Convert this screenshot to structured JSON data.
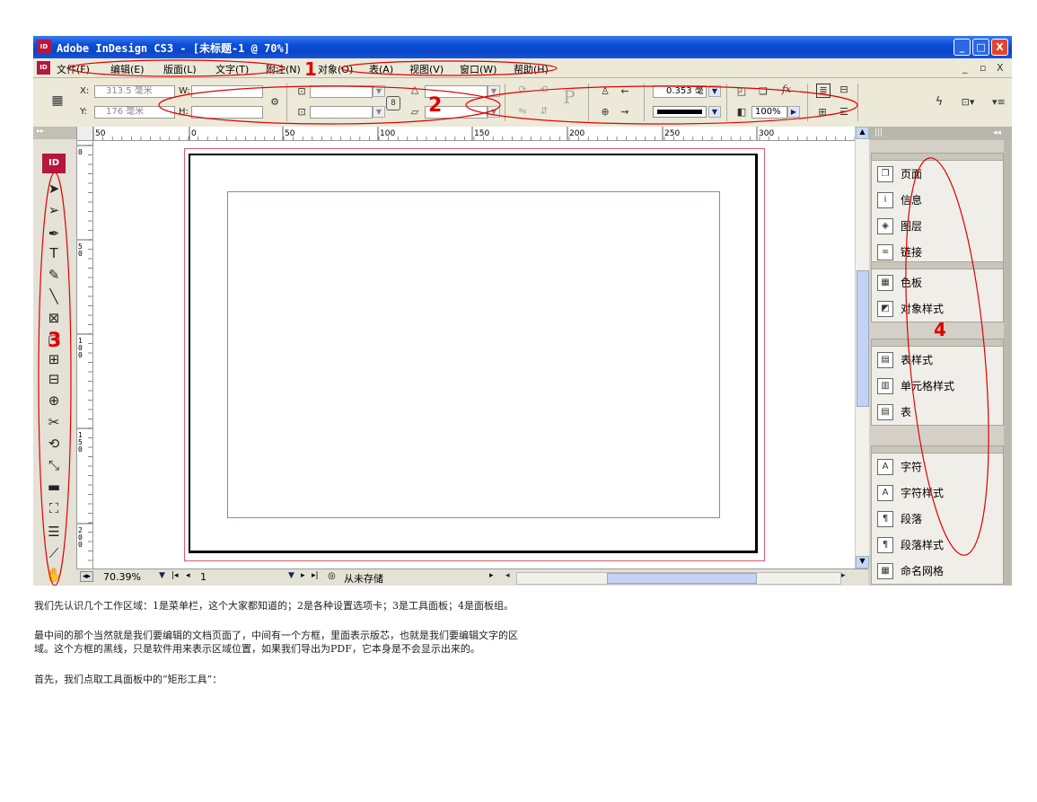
{
  "window": {
    "title": "Adobe InDesign CS3 - [未标题-1 @ 70%]",
    "logo_text": "ID",
    "buttons": {
      "minimize": "_",
      "maximize": "□",
      "close": "X"
    }
  },
  "menubar": {
    "items": [
      "文件(F)",
      "编辑(E)",
      "版面(L)",
      "文字(T)",
      "附注(N)",
      "对象(O)",
      "表(A)",
      "视图(V)",
      "窗口(W)",
      "帮助(H)"
    ],
    "mdi": {
      "minimize": "_",
      "restore": "ቹ",
      "close": "X"
    }
  },
  "control_panel": {
    "x_label": "X:",
    "x_value": "313.5 毫米",
    "y_label": "Y:",
    "y_value": "176 毫米",
    "w_label": "W:",
    "h_label": "H:",
    "stroke_weight": "0.353 毫",
    "zoom_percent": "100%"
  },
  "rulers": {
    "h_labels": [
      "50",
      "0",
      "50",
      "100",
      "150",
      "200",
      "250",
      "300"
    ],
    "v_labels": [
      "0",
      "50",
      "100",
      "150",
      "200"
    ]
  },
  "tools": {
    "logo_text": "ID",
    "items": [
      {
        "icon": "selection-icon",
        "glyph": "➤"
      },
      {
        "icon": "direct-selection-icon",
        "glyph": "➢"
      },
      {
        "icon": "pen-icon",
        "glyph": "✒"
      },
      {
        "icon": "type-icon",
        "glyph": "T"
      },
      {
        "icon": "pencil-icon",
        "glyph": "✎"
      },
      {
        "icon": "line-icon",
        "glyph": "╲"
      },
      {
        "icon": "rectangle-frame-icon",
        "glyph": "⊠"
      },
      {
        "icon": "rectangle-icon",
        "glyph": "▢"
      },
      {
        "icon": "button-icon",
        "glyph": "⊞"
      },
      {
        "icon": "table-icon",
        "glyph": "⊟"
      },
      {
        "icon": "gradient-feather-icon",
        "glyph": "⊕"
      },
      {
        "icon": "scissors-icon",
        "glyph": "✂"
      },
      {
        "icon": "rotate-icon",
        "glyph": "⟲"
      },
      {
        "icon": "scale-icon",
        "glyph": "⤡"
      },
      {
        "icon": "gradient-swatch-icon",
        "glyph": "▬"
      },
      {
        "icon": "free-transform-icon",
        "glyph": "⛶"
      },
      {
        "icon": "note-icon",
        "glyph": "☰"
      },
      {
        "icon": "eyedropper-icon",
        "glyph": "⟋"
      },
      {
        "icon": "hand-icon",
        "glyph": "✋"
      }
    ]
  },
  "status": {
    "zoom": "70.39%",
    "page": "1",
    "save_state": "从未存储"
  },
  "dock": {
    "groups": [
      {
        "items": [
          {
            "label": "页面",
            "icon": "pages-icon",
            "glyph": "❐"
          },
          {
            "label": "信息",
            "icon": "info-icon",
            "glyph": "i"
          },
          {
            "label": "图层",
            "icon": "layers-icon",
            "glyph": "◈"
          },
          {
            "label": "链接",
            "icon": "links-icon",
            "glyph": "∞"
          }
        ]
      },
      {
        "items": [
          {
            "label": "色板",
            "icon": "swatches-icon",
            "glyph": "▦"
          },
          {
            "label": "对象样式",
            "icon": "object-styles-icon",
            "glyph": "◩"
          }
        ]
      },
      {
        "items": [
          {
            "label": "表样式",
            "icon": "table-styles-icon",
            "glyph": "▤"
          },
          {
            "label": "单元格样式",
            "icon": "cell-styles-icon",
            "glyph": "▥"
          },
          {
            "label": "表",
            "icon": "table-panel-icon",
            "glyph": "▤"
          }
        ]
      },
      {
        "items": [
          {
            "label": "字符",
            "icon": "character-icon",
            "glyph": "A"
          },
          {
            "label": "字符样式",
            "icon": "character-styles-icon",
            "glyph": "A"
          },
          {
            "label": "段落",
            "icon": "paragraph-icon",
            "glyph": "¶"
          },
          {
            "label": "段落样式",
            "icon": "paragraph-styles-icon",
            "glyph": "¶"
          },
          {
            "label": "命名网格",
            "icon": "named-grids-icon",
            "glyph": "▦"
          }
        ]
      }
    ]
  },
  "annotations": {
    "n1": "1",
    "n2": "2",
    "n3": "3",
    "n4": "4",
    "color": "#e00000"
  },
  "caption": {
    "p1": "我们先认识几个工作区域：1是菜单栏，这个大家都知道的；2是各种设置选项卡；3是工具面板；4是面板组。",
    "p2a": "最中间的那个当然就是我们要编辑的文档页面了，中间有一个方框，里面表示版芯，也就是我们要编辑文字的区",
    "p2b": "域。这个方框的黑线，只是软件用来表示区域位置，如果我们导出为PDF，它本身是不会显示出来的。",
    "p3": "首先，我们点取工具面板中的“矩形工具”："
  }
}
